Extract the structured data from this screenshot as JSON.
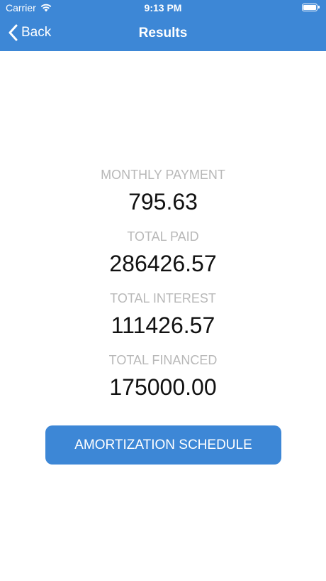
{
  "status_bar": {
    "carrier": "Carrier",
    "time": "9:13 PM"
  },
  "nav": {
    "back_label": "Back",
    "title": "Results"
  },
  "results": [
    {
      "label": "MONTHLY PAYMENT",
      "value": "795.63"
    },
    {
      "label": "TOTAL PAID",
      "value": "286426.57"
    },
    {
      "label": "TOTAL INTEREST",
      "value": "111426.57"
    },
    {
      "label": "TOTAL FINANCED",
      "value": "175000.00"
    }
  ],
  "amortization_button": {
    "label": "AMORTIZATION SCHEDULE"
  },
  "colors": {
    "accent": "#3d87d6",
    "label": "#b8b8b8",
    "value": "#111111"
  }
}
